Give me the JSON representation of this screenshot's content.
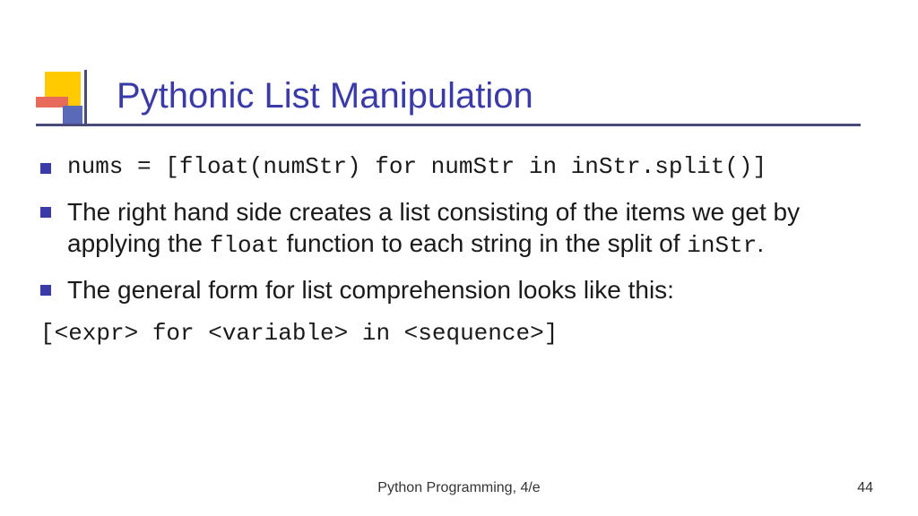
{
  "title": "Pythonic List Manipulation",
  "bullets": [
    {
      "code": true,
      "text": "nums = [float(numStr) for numStr in inStr.split()]"
    },
    {
      "code": false,
      "parts": [
        {
          "t": "The right hand side creates a list consisting of the items we get by applying the ",
          "mono": false
        },
        {
          "t": "float",
          "mono": true
        },
        {
          "t": " function to each string in the split of ",
          "mono": false
        },
        {
          "t": "inStr",
          "mono": true
        },
        {
          "t": ".",
          "mono": false
        }
      ]
    },
    {
      "code": false,
      "parts": [
        {
          "t": "The general form for list comprehension looks like this:",
          "mono": false
        }
      ]
    }
  ],
  "code_after": "[<expr> for <variable> in <sequence>]",
  "footer": {
    "center": "Python Programming, 4/e",
    "page": "44"
  }
}
